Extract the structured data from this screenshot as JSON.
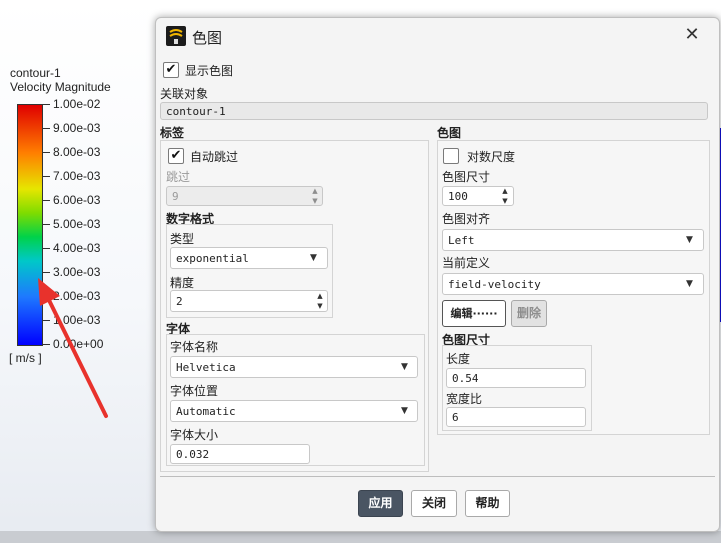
{
  "legend": {
    "title": "contour-1",
    "subtitle": "Velocity Magnitude",
    "ticks": [
      "1.00e-02",
      "9.00e-03",
      "8.00e-03",
      "7.00e-03",
      "6.00e-03",
      "5.00e-03",
      "4.00e-03",
      "3.00e-03",
      "2.00e-03",
      "1.00e-03",
      "0.00e+00"
    ],
    "units": "[ m/s ]"
  },
  "dialog": {
    "title": "色图",
    "close": "✕",
    "show_colormap": {
      "label": "显示色图",
      "checked": true
    },
    "assoc_label": "关联对象",
    "assoc_value": "contour-1",
    "labels_section": {
      "title": "标签",
      "auto_skip": {
        "label": "自动跳过",
        "checked": true
      },
      "skip_label": "跳过",
      "skip_value": "9",
      "number_format": {
        "title": "数字格式",
        "type_label": "类型",
        "type_value": "exponential",
        "precision_label": "精度",
        "precision_value": "2"
      },
      "font": {
        "title": "字体",
        "name_label": "字体名称",
        "name_value": "Helvetica",
        "position_label": "字体位置",
        "position_value": "Automatic",
        "size_label": "字体大小",
        "size_value": "0.032"
      }
    },
    "colormap_section": {
      "title": "色图",
      "log_scale": {
        "label": "对数尺度",
        "checked": false
      },
      "size_label": "色图尺寸",
      "size_value": "100",
      "align_label": "色图对齐",
      "align_value": "Left",
      "current_def_label": "当前定义",
      "current_def_value": "field-velocity",
      "edit_button": "编辑······",
      "delete_button": "删除",
      "dims": {
        "title": "色图尺寸",
        "length_label": "长度",
        "length_value": "0.54",
        "aspect_label": "宽度比",
        "aspect_value": "6"
      }
    },
    "buttons": {
      "apply": "应用",
      "close": "关闭",
      "help": "帮助"
    }
  }
}
